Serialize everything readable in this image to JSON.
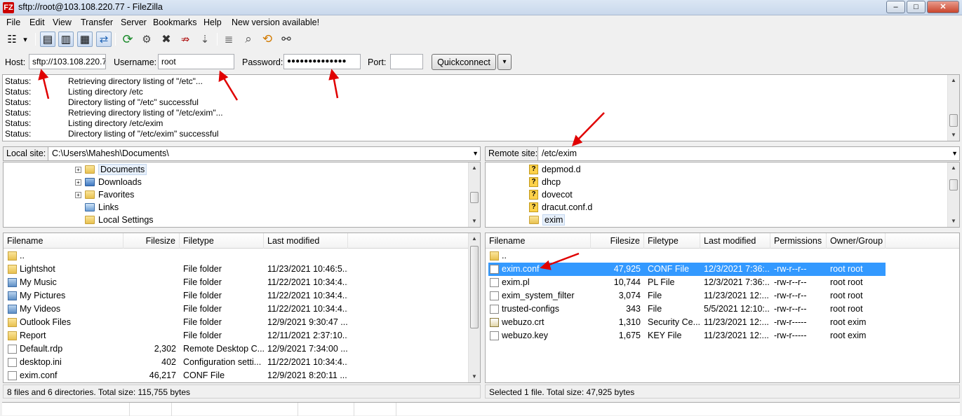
{
  "window": {
    "title": "sftp://root@103.108.220.77 - FileZilla",
    "app_icon": "FZ",
    "btn_minimize": "–",
    "btn_maximize": "□",
    "btn_close": "✕"
  },
  "menu": {
    "file": "File",
    "edit": "Edit",
    "view": "View",
    "transfer": "Transfer",
    "server": "Server",
    "bookmarks": "Bookmarks",
    "help": "Help",
    "new_version": "New version available!"
  },
  "toolbar_icons": {
    "site_manager": "☷",
    "dropdown": "▾",
    "toggle_log": "▤",
    "toggle_local": "▥",
    "toggle_remote": "▦",
    "transfer": "⇄",
    "refresh": "⟳",
    "filter": "⚙",
    "cancel": "✖",
    "disconnect": "⇏",
    "reconnect": "⇣",
    "queue": "≣",
    "search": "⌕",
    "sync": "⟲",
    "find": "⚯"
  },
  "quickconnect": {
    "host_label": "Host:",
    "host_value": "sftp://103.108.220.7",
    "username_label": "Username:",
    "username_value": "root",
    "password_label": "Password:",
    "password_value": "●●●●●●●●●●●●●●",
    "port_label": "Port:",
    "port_value": "",
    "button_label": "Quickconnect",
    "dropdown_glyph": "▾"
  },
  "log": [
    {
      "key": "Status:",
      "text": "Retrieving directory listing of \"/etc\"..."
    },
    {
      "key": "Status:",
      "text": "Listing directory /etc"
    },
    {
      "key": "Status:",
      "text": "Directory listing of \"/etc\" successful"
    },
    {
      "key": "Status:",
      "text": "Retrieving directory listing of \"/etc/exim\"..."
    },
    {
      "key": "Status:",
      "text": "Listing directory /etc/exim"
    },
    {
      "key": "Status:",
      "text": "Directory listing of \"/etc/exim\" successful"
    }
  ],
  "scroll": {
    "up": "▲",
    "down": "▼",
    "combo": "▼"
  },
  "local": {
    "site_label": "Local site:",
    "path": "C:\\Users\\Mahesh\\Documents\\",
    "tree": [
      {
        "label": "Documents",
        "expander": "+"
      },
      {
        "label": "Downloads",
        "expander": "+"
      },
      {
        "label": "Favorites",
        "expander": "+"
      },
      {
        "label": "Links",
        "expander": ""
      },
      {
        "label": "Local Settings",
        "expander": ""
      }
    ],
    "headers": {
      "name": "Filename",
      "size": "Filesize",
      "type": "Filetype",
      "modified": "Last modified"
    },
    "files": [
      {
        "name": "..",
        "size": "",
        "type": "",
        "modified": "",
        "icon": "folder-icon"
      },
      {
        "name": "Lightshot",
        "size": "",
        "type": "File folder",
        "modified": "11/23/2021 10:46:5...",
        "icon": "folder-icon"
      },
      {
        "name": "My Music",
        "size": "",
        "type": "File folder",
        "modified": "11/22/2021 10:34:4...",
        "icon": "music-folder-icon"
      },
      {
        "name": "My Pictures",
        "size": "",
        "type": "File folder",
        "modified": "11/22/2021 10:34:4...",
        "icon": "pictures-folder-icon"
      },
      {
        "name": "My Videos",
        "size": "",
        "type": "File folder",
        "modified": "11/22/2021 10:34:4...",
        "icon": "videos-folder-icon"
      },
      {
        "name": "Outlook Files",
        "size": "",
        "type": "File folder",
        "modified": "12/9/2021 9:30:47 ...",
        "icon": "folder-icon"
      },
      {
        "name": "Report",
        "size": "",
        "type": "File folder",
        "modified": "12/11/2021 2:37:10...",
        "icon": "folder-icon"
      },
      {
        "name": "Default.rdp",
        "size": "2,302",
        "type": "Remote Desktop C...",
        "modified": "12/9/2021 7:34:00 ...",
        "icon": "rdp-file-icon"
      },
      {
        "name": "desktop.ini",
        "size": "402",
        "type": "Configuration setti...",
        "modified": "11/22/2021 10:34:4...",
        "icon": "ini-file-icon"
      },
      {
        "name": "exim.conf",
        "size": "46,217",
        "type": "CONF File",
        "modified": "12/9/2021 8:20:11 ...",
        "icon": "file-icon"
      }
    ],
    "status": "8 files and 6 directories. Total size: 115,755 bytes"
  },
  "remote": {
    "site_label": "Remote site:",
    "path": "/etc/exim",
    "tree": [
      {
        "label": "depmod.d"
      },
      {
        "label": "dhcp"
      },
      {
        "label": "dovecot"
      },
      {
        "label": "dracut.conf.d"
      },
      {
        "label": "exim"
      }
    ],
    "unknown_glyph": "?",
    "headers": {
      "name": "Filename",
      "size": "Filesize",
      "type": "Filetype",
      "modified": "Last modified",
      "perms": "Permissions",
      "owner": "Owner/Group"
    },
    "files": [
      {
        "name": "..",
        "size": "",
        "type": "",
        "modified": "",
        "perms": "",
        "owner": "",
        "icon": "folder-icon"
      },
      {
        "name": "exim.conf",
        "size": "47,925",
        "type": "CONF File",
        "modified": "12/3/2021 7:36:...",
        "perms": "-rw-r--r--",
        "owner": "root root",
        "icon": "file-icon",
        "selected": true
      },
      {
        "name": "exim.pl",
        "size": "10,744",
        "type": "PL File",
        "modified": "12/3/2021 7:36:...",
        "perms": "-rw-r--r--",
        "owner": "root root",
        "icon": "file-icon"
      },
      {
        "name": "exim_system_filter",
        "size": "3,074",
        "type": "File",
        "modified": "11/23/2021 12:...",
        "perms": "-rw-r--r--",
        "owner": "root root",
        "icon": "file-icon"
      },
      {
        "name": "trusted-configs",
        "size": "343",
        "type": "File",
        "modified": "5/5/2021 12:10:...",
        "perms": "-rw-r--r--",
        "owner": "root root",
        "icon": "file-icon"
      },
      {
        "name": "webuzo.crt",
        "size": "1,310",
        "type": "Security Ce...",
        "modified": "11/23/2021 12:...",
        "perms": "-rw-r-----",
        "owner": "root exim",
        "icon": "certificate-icon"
      },
      {
        "name": "webuzo.key",
        "size": "1,675",
        "type": "KEY File",
        "modified": "11/23/2021 12:...",
        "perms": "-rw-r-----",
        "owner": "root exim",
        "icon": "file-icon"
      }
    ],
    "status": "Selected 1 file. Total size: 47,925 bytes"
  },
  "colors": {
    "selection": "#3399ff",
    "annotation": "#e00000"
  }
}
